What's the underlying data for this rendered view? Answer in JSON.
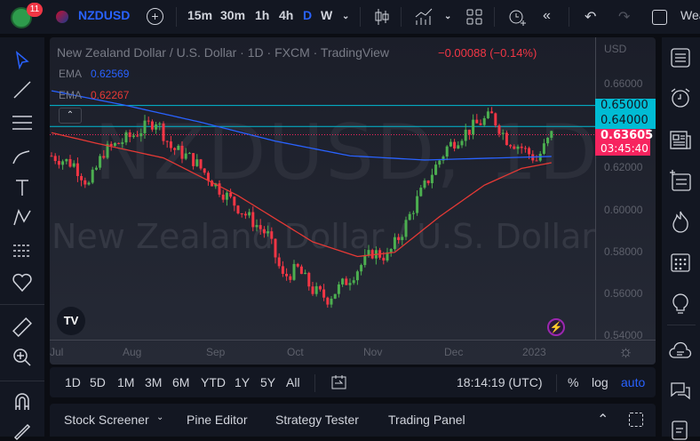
{
  "topbar": {
    "badge": "11",
    "symbol": "NZDUSD",
    "intervals": [
      "15m",
      "30m",
      "1h",
      "4h",
      "D",
      "W"
    ],
    "active_interval": "D",
    "right_text": "Wea"
  },
  "legend": {
    "title": "New Zealand Dollar / U.S. Dollar · 1D · FXCM · TradingView",
    "change": "−0.00088 (−0.14%)",
    "ema1_label": "EMA",
    "ema1_value": "0.62569",
    "ema2_label": "EMA",
    "ema2_value": "0.62267"
  },
  "watermark": {
    "symbol": "NZDUSD, 1D",
    "name": "New Zealand Dollar / U.S. Dollar"
  },
  "price_axis": {
    "currency": "USD",
    "ticks": [
      "0.66000",
      "0.62000",
      "0.60000",
      "0.58000",
      "0.56000",
      "0.54000"
    ],
    "tick_values": [
      0.66,
      0.62,
      0.6,
      0.58,
      0.56,
      0.54
    ],
    "level1": "0.65000",
    "level2": "0.64000",
    "last_price": "0.63605",
    "countdown": "03:45:40"
  },
  "time_axis": {
    "labels": [
      "Jul",
      "Aug",
      "Sep",
      "Oct",
      "Nov",
      "Dec",
      "2023"
    ]
  },
  "colors": {
    "up": "#4caf50",
    "down": "#f23645",
    "ema_blue": "#2962ff",
    "ema_red": "#e53935",
    "level": "#00bcd4",
    "last": "#f7245f",
    "accent": "#2962ff"
  },
  "chart_data": {
    "type": "candlestick",
    "ylim": [
      0.535,
      0.675
    ],
    "n": 135,
    "price_path": [
      [
        0,
        0.626
      ],
      [
        6,
        0.622
      ],
      [
        10,
        0.612
      ],
      [
        14,
        0.628
      ],
      [
        22,
        0.636
      ],
      [
        28,
        0.643
      ],
      [
        32,
        0.63
      ],
      [
        38,
        0.624
      ],
      [
        44,
        0.612
      ],
      [
        52,
        0.598
      ],
      [
        58,
        0.588
      ],
      [
        62,
        0.568
      ],
      [
        66,
        0.572
      ],
      [
        70,
        0.562
      ],
      [
        74,
        0.558
      ],
      [
        80,
        0.568
      ],
      [
        86,
        0.58
      ],
      [
        90,
        0.578
      ],
      [
        94,
        0.59
      ],
      [
        98,
        0.605
      ],
      [
        102,
        0.618
      ],
      [
        106,
        0.63
      ],
      [
        110,
        0.636
      ],
      [
        114,
        0.641
      ],
      [
        118,
        0.645
      ],
      [
        122,
        0.634
      ],
      [
        126,
        0.63
      ],
      [
        130,
        0.624
      ],
      [
        134,
        0.636
      ]
    ],
    "ema_blue": [
      [
        0,
        0.657
      ],
      [
        20,
        0.65
      ],
      [
        40,
        0.642
      ],
      [
        60,
        0.633
      ],
      [
        80,
        0.626
      ],
      [
        100,
        0.624
      ],
      [
        120,
        0.625
      ],
      [
        134,
        0.6257
      ]
    ],
    "ema_red": [
      [
        0,
        0.637
      ],
      [
        12,
        0.632
      ],
      [
        30,
        0.625
      ],
      [
        50,
        0.607
      ],
      [
        70,
        0.585
      ],
      [
        82,
        0.578
      ],
      [
        92,
        0.58
      ],
      [
        104,
        0.597
      ],
      [
        116,
        0.612
      ],
      [
        126,
        0.62
      ],
      [
        134,
        0.6227
      ]
    ]
  },
  "range": {
    "buttons": [
      "1D",
      "5D",
      "1M",
      "3M",
      "6M",
      "YTD",
      "1Y",
      "5Y",
      "All"
    ],
    "clock": "18:14:19 (UTC)",
    "pct": "%",
    "log": "log",
    "auto": "auto"
  },
  "tabs": {
    "items": [
      "Stock Screener",
      "Pine Editor",
      "Strategy Tester",
      "Trading Panel"
    ]
  }
}
